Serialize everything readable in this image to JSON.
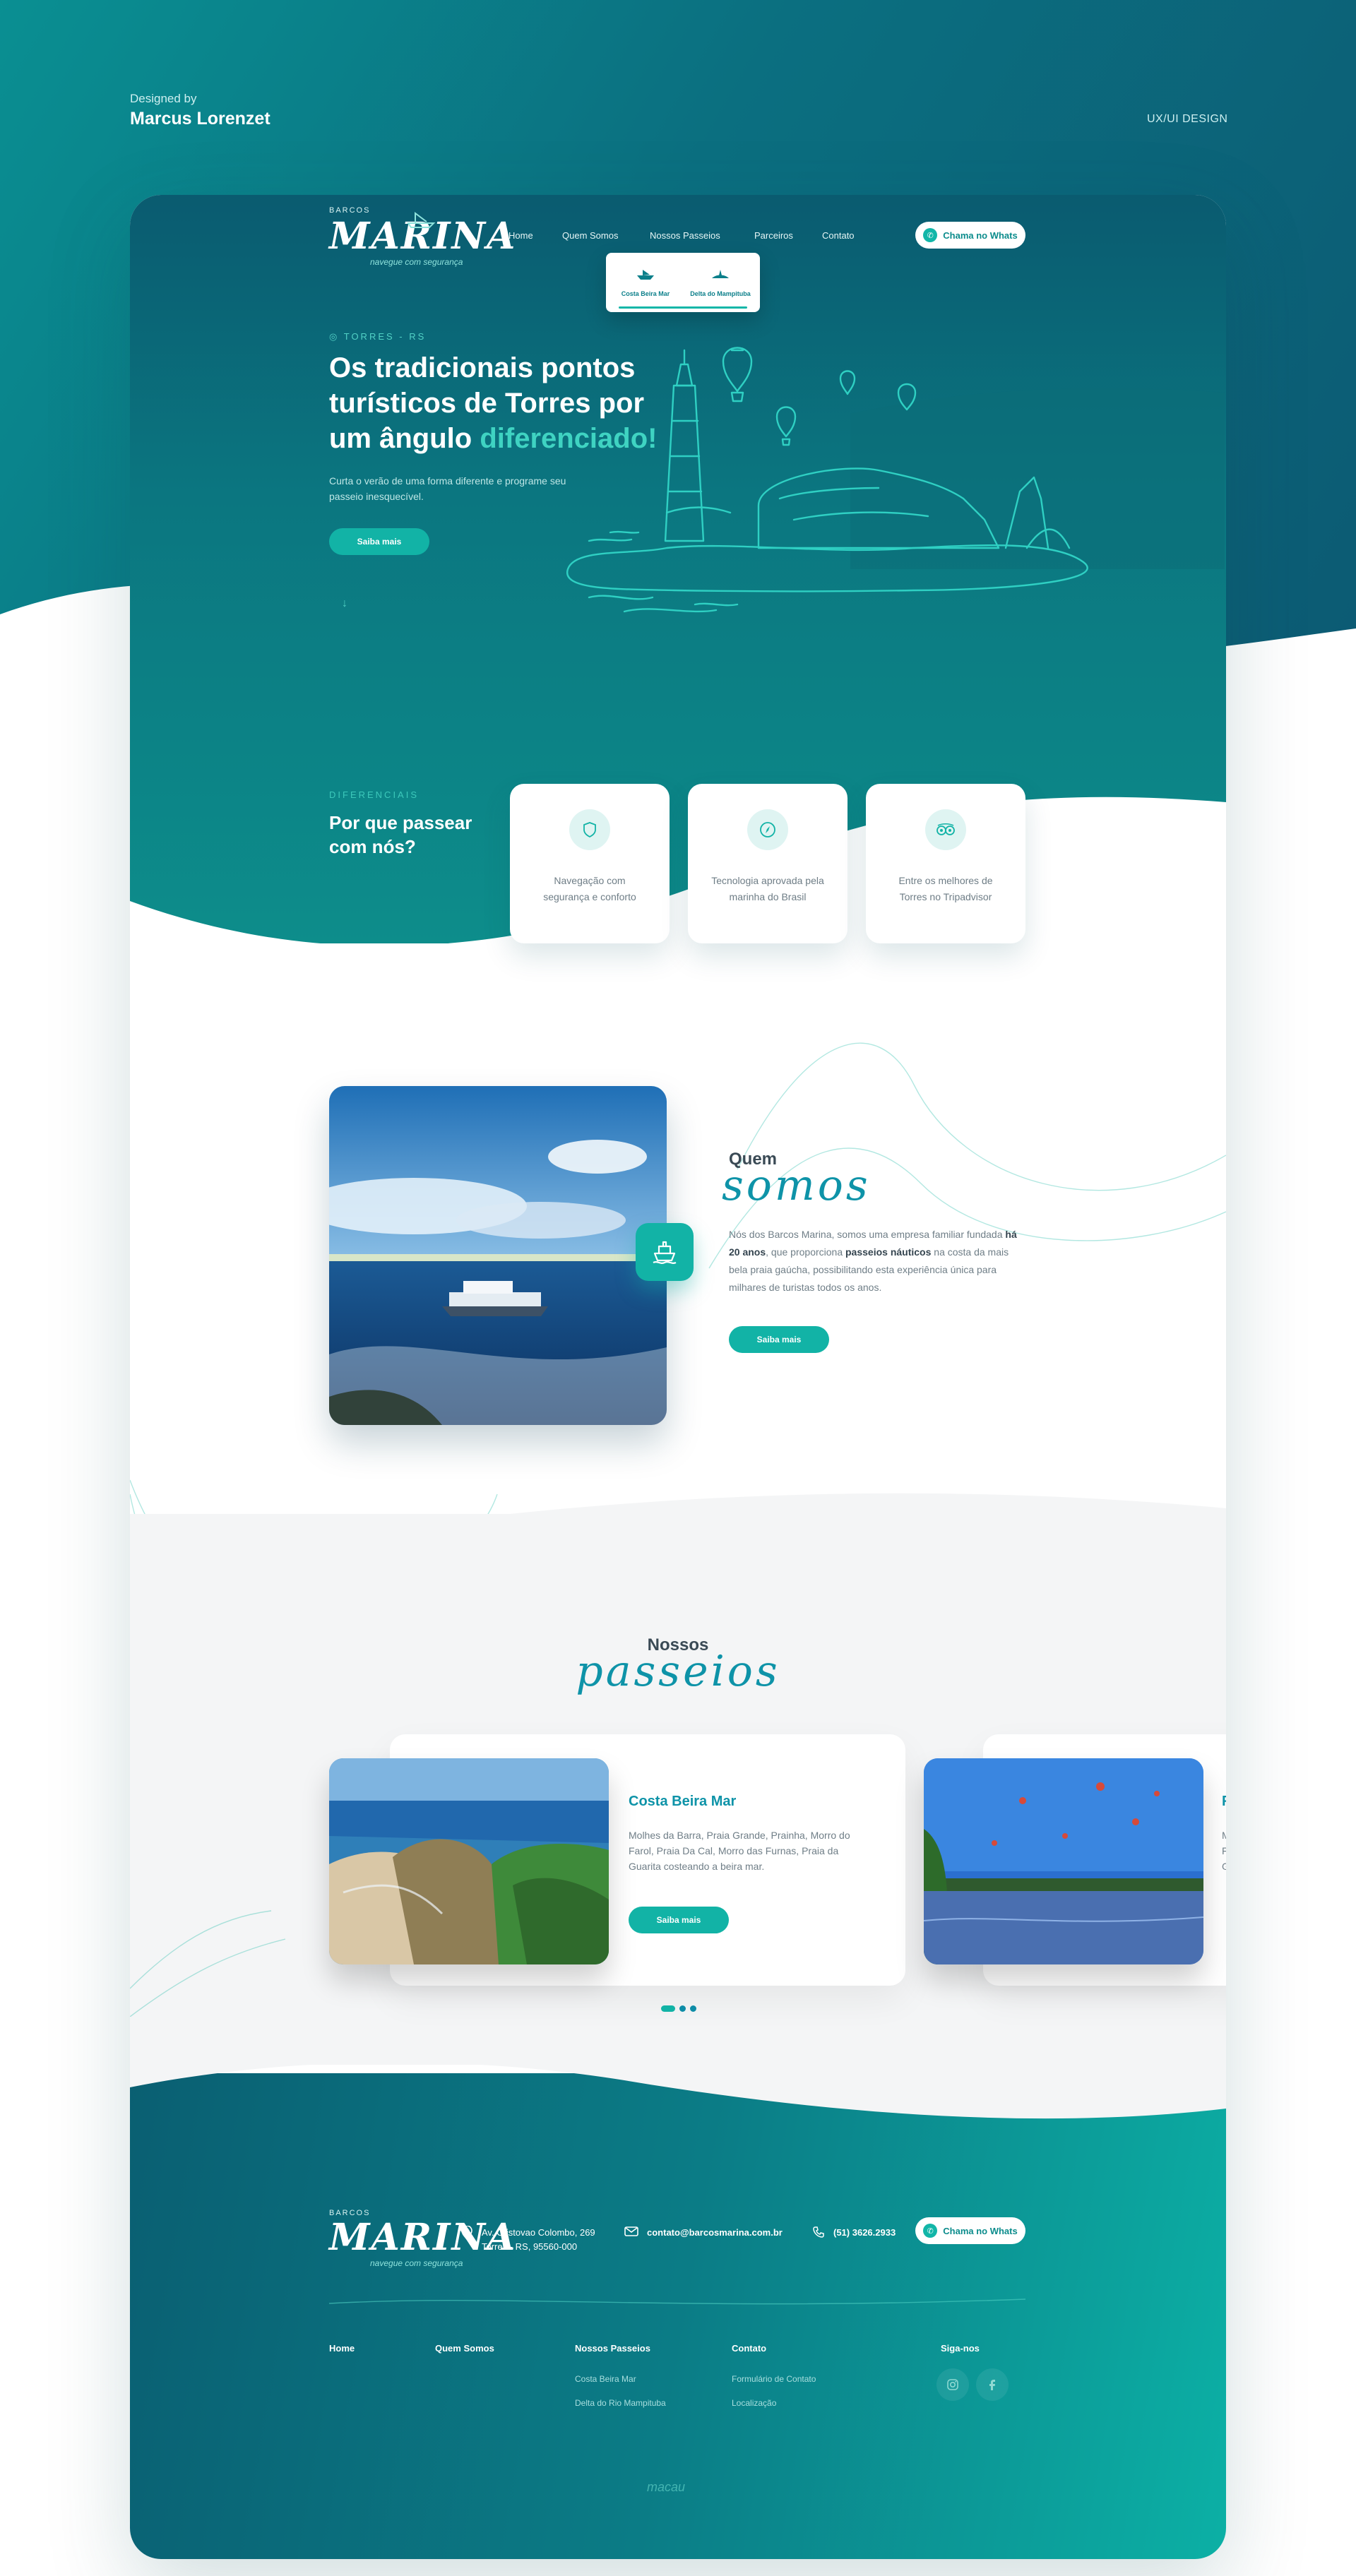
{
  "meta": {
    "designed_by": "Designed by",
    "designer": "Marcus Lorenzet",
    "category": "UX/UI DESIGN"
  },
  "brand": {
    "small": "BARCOS",
    "name": "MARINA",
    "tagline": "navegue com segurança"
  },
  "nav": {
    "items": [
      "Home",
      "Quem Somos",
      "Nossos Passeios",
      "Parceiros",
      "Contato"
    ],
    "cta": "Chama no Whats",
    "dropdown": [
      "Costa Beira Mar",
      "Delta do Mampituba"
    ]
  },
  "hero": {
    "location": "TORRES - RS",
    "title_line1": "Os tradicionais pontos",
    "title_line2": "turísticos de Torres por",
    "title_line3_a": "um ângulo ",
    "title_line3_b": "diferenciado!",
    "subtitle": "Curta o verão de uma forma diferente e programe seu passeio inesquecível.",
    "button": "Saiba mais",
    "scroll": "↓"
  },
  "diferenciais": {
    "eyebrow": "DIFERENCIAIS",
    "title": "Por que passear com nós?",
    "items": [
      {
        "icon": "shield-icon",
        "text": "Navegação com segurança e conforto"
      },
      {
        "icon": "compass-icon",
        "text": "Tecnologia aprovada pela marinha do Brasil"
      },
      {
        "icon": "tripadvisor-icon",
        "text": "Entre os melhores de Torres no Tripadvisor"
      }
    ]
  },
  "about": {
    "title_a": "Quem",
    "title_b": "somos",
    "text_1": "Nós dos Barcos Marina, somos uma empresa familiar fundada ",
    "text_bold_1": "há 20 anos",
    "text_2": ", que proporciona ",
    "text_bold_2": "passeios náuticos",
    "text_3": " na costa da mais bela praia gaúcha, possibilitando esta experiência única para milhares de turistas todos os anos.",
    "button": "Saiba mais"
  },
  "tours": {
    "title_a": "Nossos",
    "title_b": "passeios",
    "items": [
      {
        "name": "Costa Beira Mar",
        "description": "Molhes da Barra, Praia Grande, Prainha, Morro do Farol, Praia Da Cal, Morro das Furnas, Praia da Guarita costeando a beira mar.",
        "button": "Saiba mais"
      }
    ],
    "next_partial": {
      "initial": "F",
      "lines": [
        "M",
        "F",
        "G"
      ]
    }
  },
  "footer": {
    "address_line1": "Av. Cristovao Colombo, 269",
    "address_line2": "Torres - RS, 95560-000",
    "email": "contato@barcosmarina.com.br",
    "phone": "(51) 3626.2933",
    "cta": "Chama no Whats",
    "columns": {
      "home": "Home",
      "quem_somos": "Quem Somos",
      "passeios": "Nossos Passeios",
      "passeios_links": [
        "Costa Beira Mar",
        "Delta do Rio Mampituba"
      ],
      "contato": "Contato",
      "contato_links": [
        "Formulário de Contato",
        "Localização"
      ],
      "siga": "Siga-nos"
    },
    "credit": "macau"
  },
  "colors": {
    "teal_dark": "#0a5b70",
    "teal": "#0b7f86",
    "accent": "#12b3a6",
    "script": "#0e93a8"
  }
}
